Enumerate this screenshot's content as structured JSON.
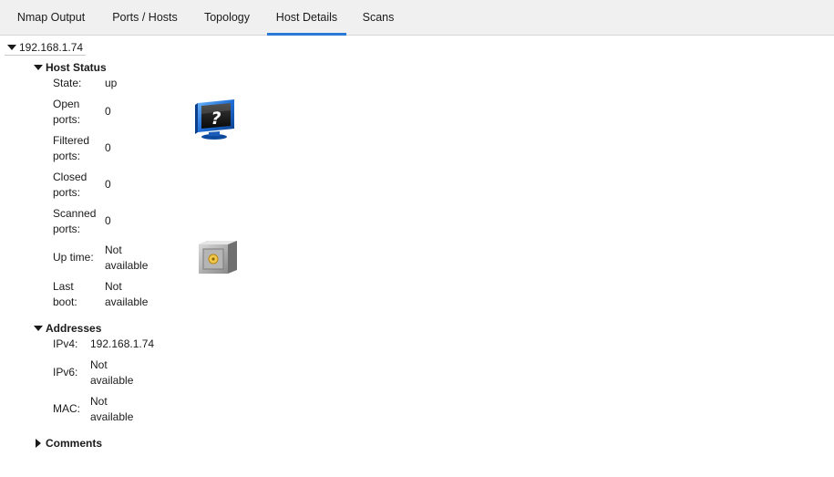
{
  "tabs": [
    {
      "label": "Nmap Output"
    },
    {
      "label": "Ports / Hosts"
    },
    {
      "label": "Topology"
    },
    {
      "label": "Host Details",
      "active": true
    },
    {
      "label": "Scans"
    }
  ],
  "host": {
    "address": "192.168.1.74"
  },
  "host_status": {
    "title": "Host Status",
    "state_label": "State:",
    "state_value": "up",
    "open_label_1": "Open",
    "open_label_2": "ports:",
    "open_value": "0",
    "filtered_label_1": "Filtered",
    "filtered_label_2": "ports:",
    "filtered_value": "0",
    "closed_label_1": "Closed",
    "closed_label_2": "ports:",
    "closed_value": "0",
    "scanned_label_1": "Scanned",
    "scanned_label_2": "ports:",
    "scanned_value": "0",
    "uptime_label": "Up time:",
    "uptime_value_1": "Not",
    "uptime_value_2": "available",
    "lastboot_label_1": "Last",
    "lastboot_label_2": "boot:",
    "lastboot_value_1": "Not",
    "lastboot_value_2": "available",
    "os_icon": "unknown-os-monitor-icon",
    "vulnerability_icon": "safe-vault-icon"
  },
  "addresses": {
    "title": "Addresses",
    "ipv4_label": "IPv4:",
    "ipv4_value": "192.168.1.74",
    "ipv6_label": "IPv6:",
    "ipv6_value_1": "Not",
    "ipv6_value_2": "available",
    "mac_label": "MAC:",
    "mac_value_1": "Not",
    "mac_value_2": "available"
  },
  "comments": {
    "title": "Comments"
  },
  "colors": {
    "tab_bar_bg": "#f0f0f0",
    "active_tab_underline": "#2a7ad5"
  }
}
